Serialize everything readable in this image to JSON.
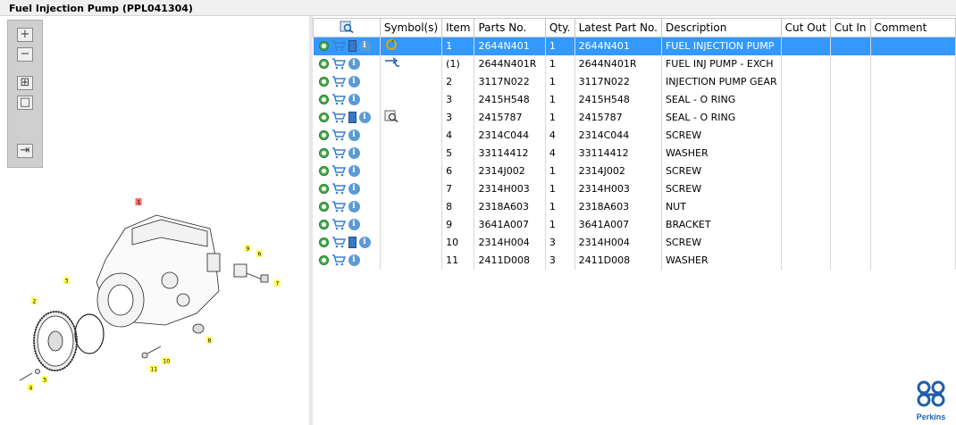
{
  "window": {
    "title": "Fuel Injection Pump (PPL041304)"
  },
  "toolbar": {
    "buttons": [
      {
        "name": "zoom-in-button",
        "glyph": "+"
      },
      {
        "name": "zoom-out-button",
        "glyph": "−"
      },
      {
        "name": "fit-all-button",
        "glyph": "⊞"
      },
      {
        "name": "fit-page-button",
        "glyph": "□"
      },
      {
        "name": "export-button",
        "glyph": "⇥"
      }
    ]
  },
  "drawing": {
    "callouts": [
      "1",
      "2",
      "3",
      "4",
      "5",
      "6",
      "7",
      "8",
      "9",
      "10",
      "11"
    ]
  },
  "table": {
    "columns": [
      "",
      "Symbol(s)",
      "Item",
      "Parts No.",
      "Qty.",
      "Latest Part No.",
      "Description",
      "Cut Out",
      "Cut In",
      "Comment"
    ],
    "rows": [
      {
        "item": "1",
        "part": "2644N401",
        "qty": "1",
        "latest": "2644N401",
        "desc": "FUEL INJECTION PUMP",
        "icons": [
          "gear-icon",
          "cart-icon",
          "book-icon",
          "info-icon"
        ],
        "symbol": "replace-icon",
        "selected": true
      },
      {
        "item": "(1)",
        "part": "2644N401R",
        "qty": "1",
        "latest": "2644N401R",
        "desc": "FUEL INJ PUMP - EXCH",
        "icons": [
          "gear-icon",
          "cart-icon",
          "info-icon"
        ],
        "symbol": "exchange-icon",
        "selected": false
      },
      {
        "item": "2",
        "part": "3117N022",
        "qty": "1",
        "latest": "3117N022",
        "desc": "INJECTION PUMP GEAR",
        "icons": [
          "gear-icon",
          "cart-icon",
          "info-icon"
        ],
        "symbol": "",
        "selected": false
      },
      {
        "item": "3",
        "part": "2415H548",
        "qty": "1",
        "latest": "2415H548",
        "desc": "SEAL - O RING",
        "icons": [
          "gear-icon",
          "cart-icon",
          "info-icon"
        ],
        "symbol": "",
        "selected": false
      },
      {
        "item": "3",
        "part": "2415787",
        "qty": "1",
        "latest": "2415787",
        "desc": "SEAL - O RING",
        "icons": [
          "gear-icon",
          "cart-icon",
          "book-icon",
          "info-icon"
        ],
        "symbol": "document-search-icon",
        "selected": false
      },
      {
        "item": "4",
        "part": "2314C044",
        "qty": "4",
        "latest": "2314C044",
        "desc": "SCREW",
        "icons": [
          "gear-icon",
          "cart-icon",
          "info-icon"
        ],
        "symbol": "",
        "selected": false
      },
      {
        "item": "5",
        "part": "33114412",
        "qty": "4",
        "latest": "33114412",
        "desc": "WASHER",
        "icons": [
          "gear-icon",
          "cart-icon",
          "info-icon"
        ],
        "symbol": "",
        "selected": false
      },
      {
        "item": "6",
        "part": "2314J002",
        "qty": "1",
        "latest": "2314J002",
        "desc": "SCREW",
        "icons": [
          "gear-icon",
          "cart-icon",
          "info-icon"
        ],
        "symbol": "",
        "selected": false
      },
      {
        "item": "7",
        "part": "2314H003",
        "qty": "1",
        "latest": "2314H003",
        "desc": "SCREW",
        "icons": [
          "gear-icon",
          "cart-icon",
          "info-icon"
        ],
        "symbol": "",
        "selected": false
      },
      {
        "item": "8",
        "part": "2318A603",
        "qty": "1",
        "latest": "2318A603",
        "desc": "NUT",
        "icons": [
          "gear-icon",
          "cart-icon",
          "info-icon"
        ],
        "symbol": "",
        "selected": false
      },
      {
        "item": "9",
        "part": "3641A007",
        "qty": "1",
        "latest": "3641A007",
        "desc": "BRACKET",
        "icons": [
          "gear-icon",
          "cart-icon",
          "info-icon"
        ],
        "symbol": "",
        "selected": false
      },
      {
        "item": "10",
        "part": "2314H004",
        "qty": "3",
        "latest": "2314H004",
        "desc": "SCREW",
        "icons": [
          "gear-icon",
          "cart-icon",
          "book-icon",
          "info-icon"
        ],
        "symbol": "",
        "selected": false
      },
      {
        "item": "11",
        "part": "2411D008",
        "qty": "3",
        "latest": "2411D008",
        "desc": "WASHER",
        "icons": [
          "gear-icon",
          "cart-icon",
          "info-icon"
        ],
        "symbol": "",
        "selected": false
      }
    ]
  },
  "brand": {
    "name": "Perkins",
    "color": "#1f5fa8"
  },
  "colors": {
    "selection": "#3399ff",
    "callout": "#ffff66",
    "callout_selected": "#ff6b6b"
  }
}
